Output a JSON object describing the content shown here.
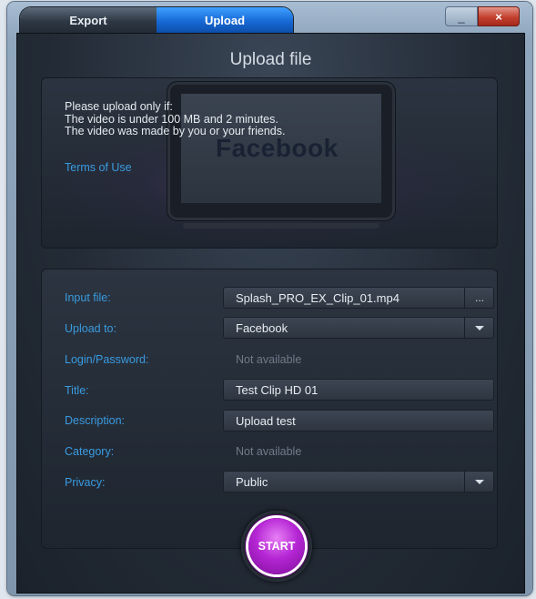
{
  "tabs": {
    "export": "Export",
    "upload": "Upload"
  },
  "window_buttons": {
    "minimize": "_",
    "close": "×"
  },
  "heading": "Upload file",
  "notice": {
    "line1": "Please upload only if:",
    "line2": "The video is under 100 MB and 2 minutes.",
    "line3": "The video was made by you or your friends.",
    "watermark": "Facebook"
  },
  "terms_link": "Terms of Use",
  "form": {
    "input_file": {
      "label": "Input file:",
      "value": "Splash_PRO_EX_Clip_01.mp4",
      "browse": "..."
    },
    "upload_to": {
      "label": "Upload to:",
      "value": "Facebook"
    },
    "login": {
      "label": "Login/Password:",
      "value": "Not available"
    },
    "title": {
      "label": "Title:",
      "value": "Test Clip HD 01"
    },
    "description": {
      "label": "Description:",
      "value": "Upload test"
    },
    "category": {
      "label": "Category:",
      "value": "Not available"
    },
    "privacy": {
      "label": "Privacy:",
      "value": "Public"
    }
  },
  "start_button": "START",
  "colors": {
    "accent_blue": "#3a9be0",
    "start_purple": "#b526d4",
    "active_tab": "#1769d6"
  }
}
